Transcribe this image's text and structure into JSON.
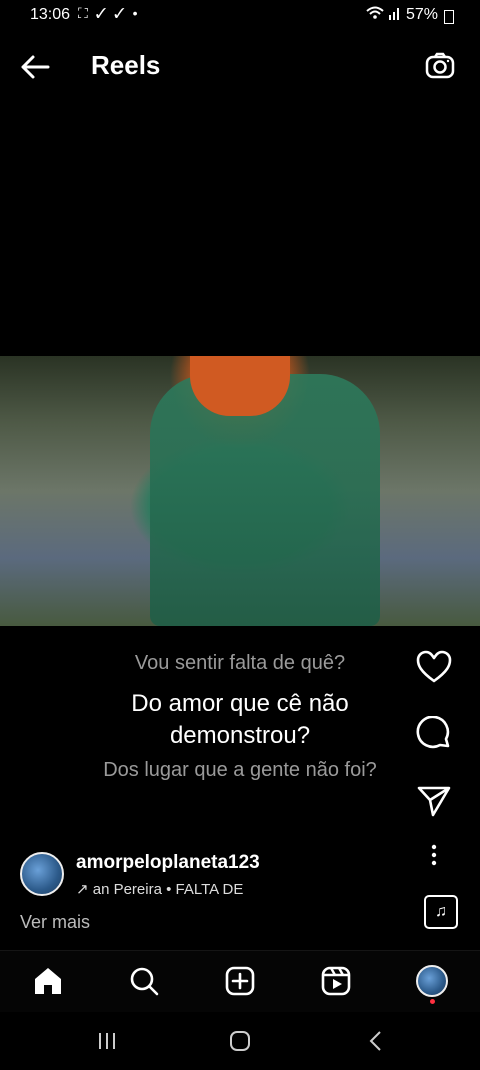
{
  "status_bar": {
    "time": "13:06",
    "notification_icons": "⛶ ✓ ✓ •",
    "battery": "57%"
  },
  "header": {
    "title": "Reels",
    "back_icon": "arrow-left-icon",
    "camera_icon": "camera-icon"
  },
  "lyrics": {
    "line_prev": "Vou sentir falta de quê?",
    "line_current": "Do amor que cê não demonstrou?",
    "line_next": "Dos lugar que a gente não foi?"
  },
  "post": {
    "username": "amorpeloplaneta123",
    "audio_text": "↗ an Pereira • FALTA DE",
    "more_label": "Ver mais"
  },
  "actions": {
    "like_icon": "heart-icon",
    "comment_icon": "comment-icon",
    "share_icon": "send-icon",
    "more_icon": "more-vertical-icon",
    "music_icon": "music-note-icon"
  },
  "tabs": [
    "home-icon",
    "search-icon",
    "create-icon",
    "reels-icon",
    "profile-avatar"
  ],
  "system_nav": [
    "recent-apps-icon",
    "home-button-icon",
    "back-icon"
  ],
  "colors": {
    "background": "#000000",
    "text": "#ffffff",
    "muted": "#9a9a9a",
    "notification_dot": "#ff3040"
  }
}
